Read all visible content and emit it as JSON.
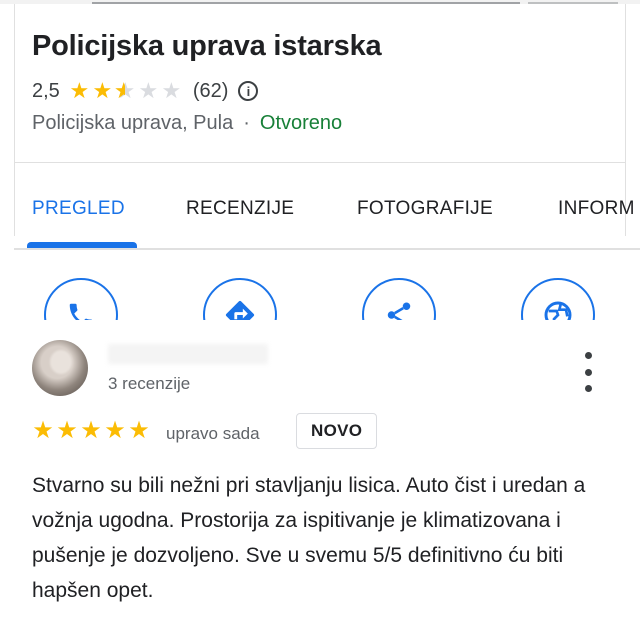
{
  "place": {
    "title": "Policijska uprava istarska",
    "rating": "2,5",
    "rating_value": 2.5,
    "rating_max": 5,
    "review_count": "(62)",
    "category": "Policijska uprava, Pula",
    "separator": "·",
    "status": "Otvoreno",
    "status_color": "#188038"
  },
  "tabs": [
    {
      "label": "PREGLED",
      "active": true
    },
    {
      "label": "RECENZIJE",
      "active": false
    },
    {
      "label": "FOTOGRAFIJE",
      "active": false
    },
    {
      "label": "INFORM",
      "active": false
    }
  ],
  "actions": [
    {
      "icon": "phone-icon"
    },
    {
      "icon": "directions-icon"
    },
    {
      "icon": "share-icon"
    },
    {
      "icon": "globe-icon"
    }
  ],
  "review": {
    "reviewer_reviews": "3 recenzije",
    "stars": 5,
    "time": "upravo sada",
    "badge": "NOVO",
    "text": "Stvarno su bili nežni pri stavljanju lisica. Auto čist i uredan a vožnja ugodna. Prostorija za ispitivanje je klimatizovana i pušenje je dozvoljeno. Sve u svemu 5/5 definitivno ću biti hapšen opet."
  },
  "colors": {
    "accent": "#1a73e8",
    "star": "#fbbc04"
  }
}
